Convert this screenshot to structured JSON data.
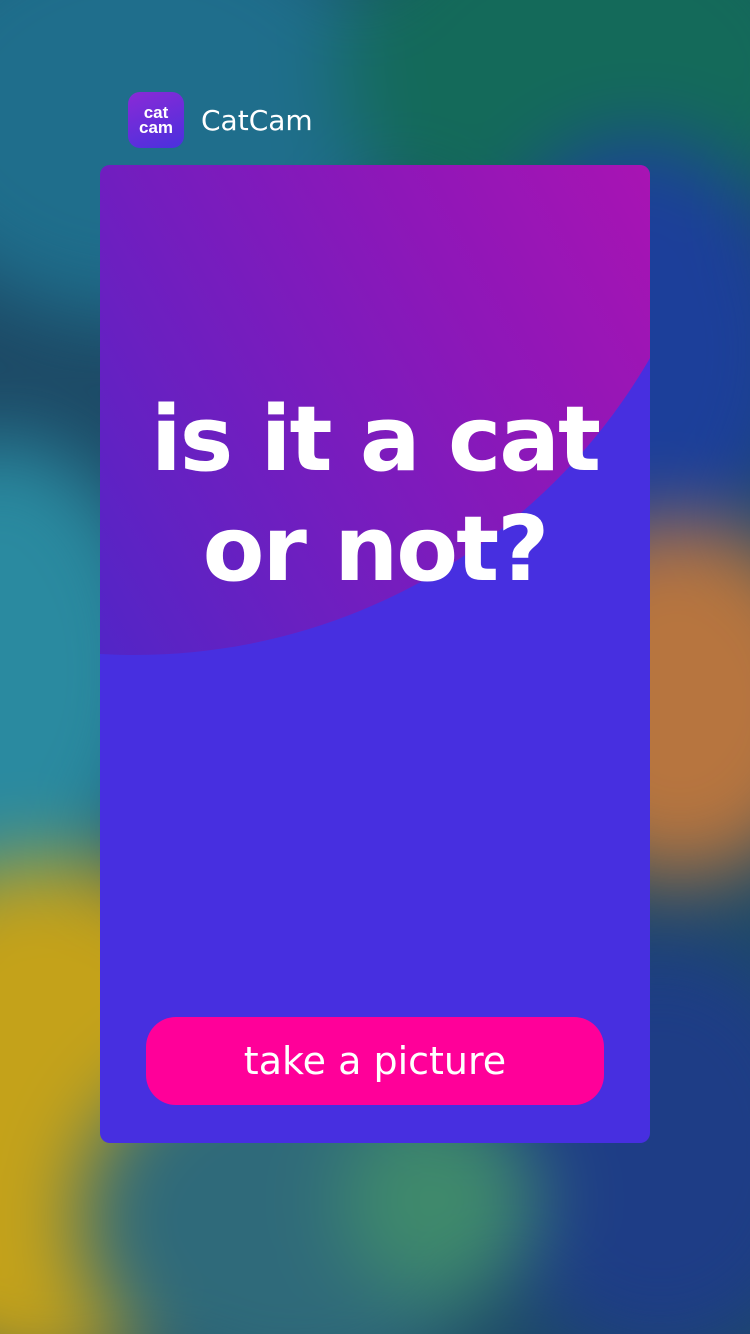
{
  "app": {
    "icon_line1": "cat",
    "icon_line2": "cam",
    "name": "CatCam"
  },
  "card": {
    "headline_line1": "is it a cat",
    "headline_line2": "or not?",
    "button_label": "take a picture"
  },
  "colors": {
    "card_background": "#472fe0",
    "button_background": "#ff0099",
    "arc_gradient_end": "#c610ad",
    "text": "#ffffff"
  }
}
